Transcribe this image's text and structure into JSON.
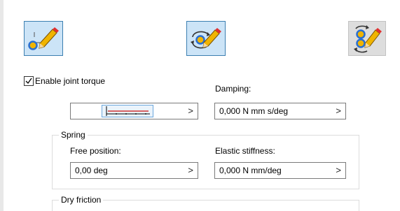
{
  "toolbar": {
    "mode_buttons": [
      {
        "icon": "point-pencil-icon",
        "selected": true
      },
      {
        "icon": "rotation-pencil-icon",
        "selected": true
      },
      {
        "icon": "two-joints-pencil-icon",
        "selected": false
      }
    ]
  },
  "joint_torque": {
    "enable_label": "Enable joint torque",
    "enabled": true,
    "graph_icon": "torque-graph-icon",
    "arrow": ">"
  },
  "damping": {
    "label": "Damping:",
    "value": "0,000 N mm s/deg",
    "arrow": ">"
  },
  "spring": {
    "title": "Spring",
    "free_position": {
      "label": "Free position:",
      "value": "0,00 deg",
      "arrow": ">"
    },
    "elastic_stiffness": {
      "label": "Elastic stiffness:",
      "value": "0,000 N mm/deg",
      "arrow": ">"
    }
  },
  "dry_friction": {
    "title": "Dry friction"
  },
  "colors": {
    "selected_bg": "#cce4f7",
    "selected_border": "#3c7fb1",
    "icon_yellow": "#f0b400",
    "icon_blue": "#2a6fd1"
  }
}
